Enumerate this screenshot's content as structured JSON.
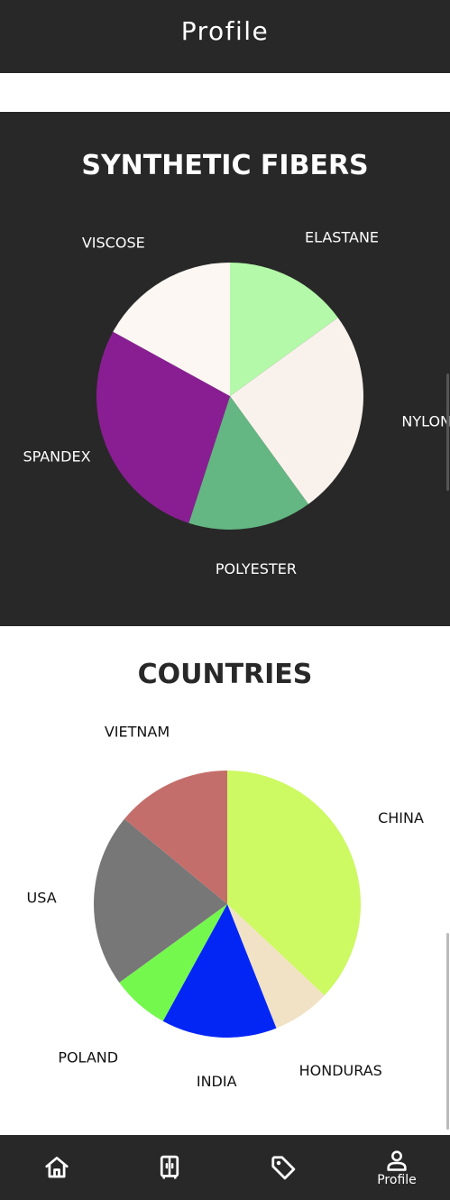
{
  "header": {
    "title": "Profile"
  },
  "chart_data": [
    {
      "type": "pie",
      "title": "SYNTHETIC FIBERS",
      "slices": [
        {
          "label": "ELASTANE",
          "value": 15,
          "color": "#b4f9a9"
        },
        {
          "label": "NYLON",
          "value": 25,
          "color": "#f9f2ec"
        },
        {
          "label": "POLYESTER",
          "value": 15,
          "color": "#64b782"
        },
        {
          "label": "SPANDEX",
          "value": 28,
          "color": "#891e93"
        },
        {
          "label": "VISCOSE",
          "value": 17,
          "color": "#fcf7f2"
        }
      ]
    },
    {
      "type": "pie",
      "title": "COUNTRIES",
      "slices": [
        {
          "label": "CHINA",
          "value": 37,
          "color": "#cdf962"
        },
        {
          "label": "HONDURAS",
          "value": 7,
          "color": "#f1e2c5"
        },
        {
          "label": "INDIA",
          "value": 14,
          "color": "#0426f5"
        },
        {
          "label": "POLAND",
          "value": 7,
          "color": "#75f84e"
        },
        {
          "label": "USA",
          "value": 21,
          "color": "#777777"
        },
        {
          "label": "VIETNAM",
          "value": 14,
          "color": "#c46e6b"
        }
      ]
    }
  ],
  "nav": {
    "items": [
      {
        "icon": "home-icon"
      },
      {
        "icon": "wardrobe-icon"
      },
      {
        "icon": "tag-icon"
      },
      {
        "icon": "person-icon",
        "label": "Profile"
      }
    ]
  }
}
